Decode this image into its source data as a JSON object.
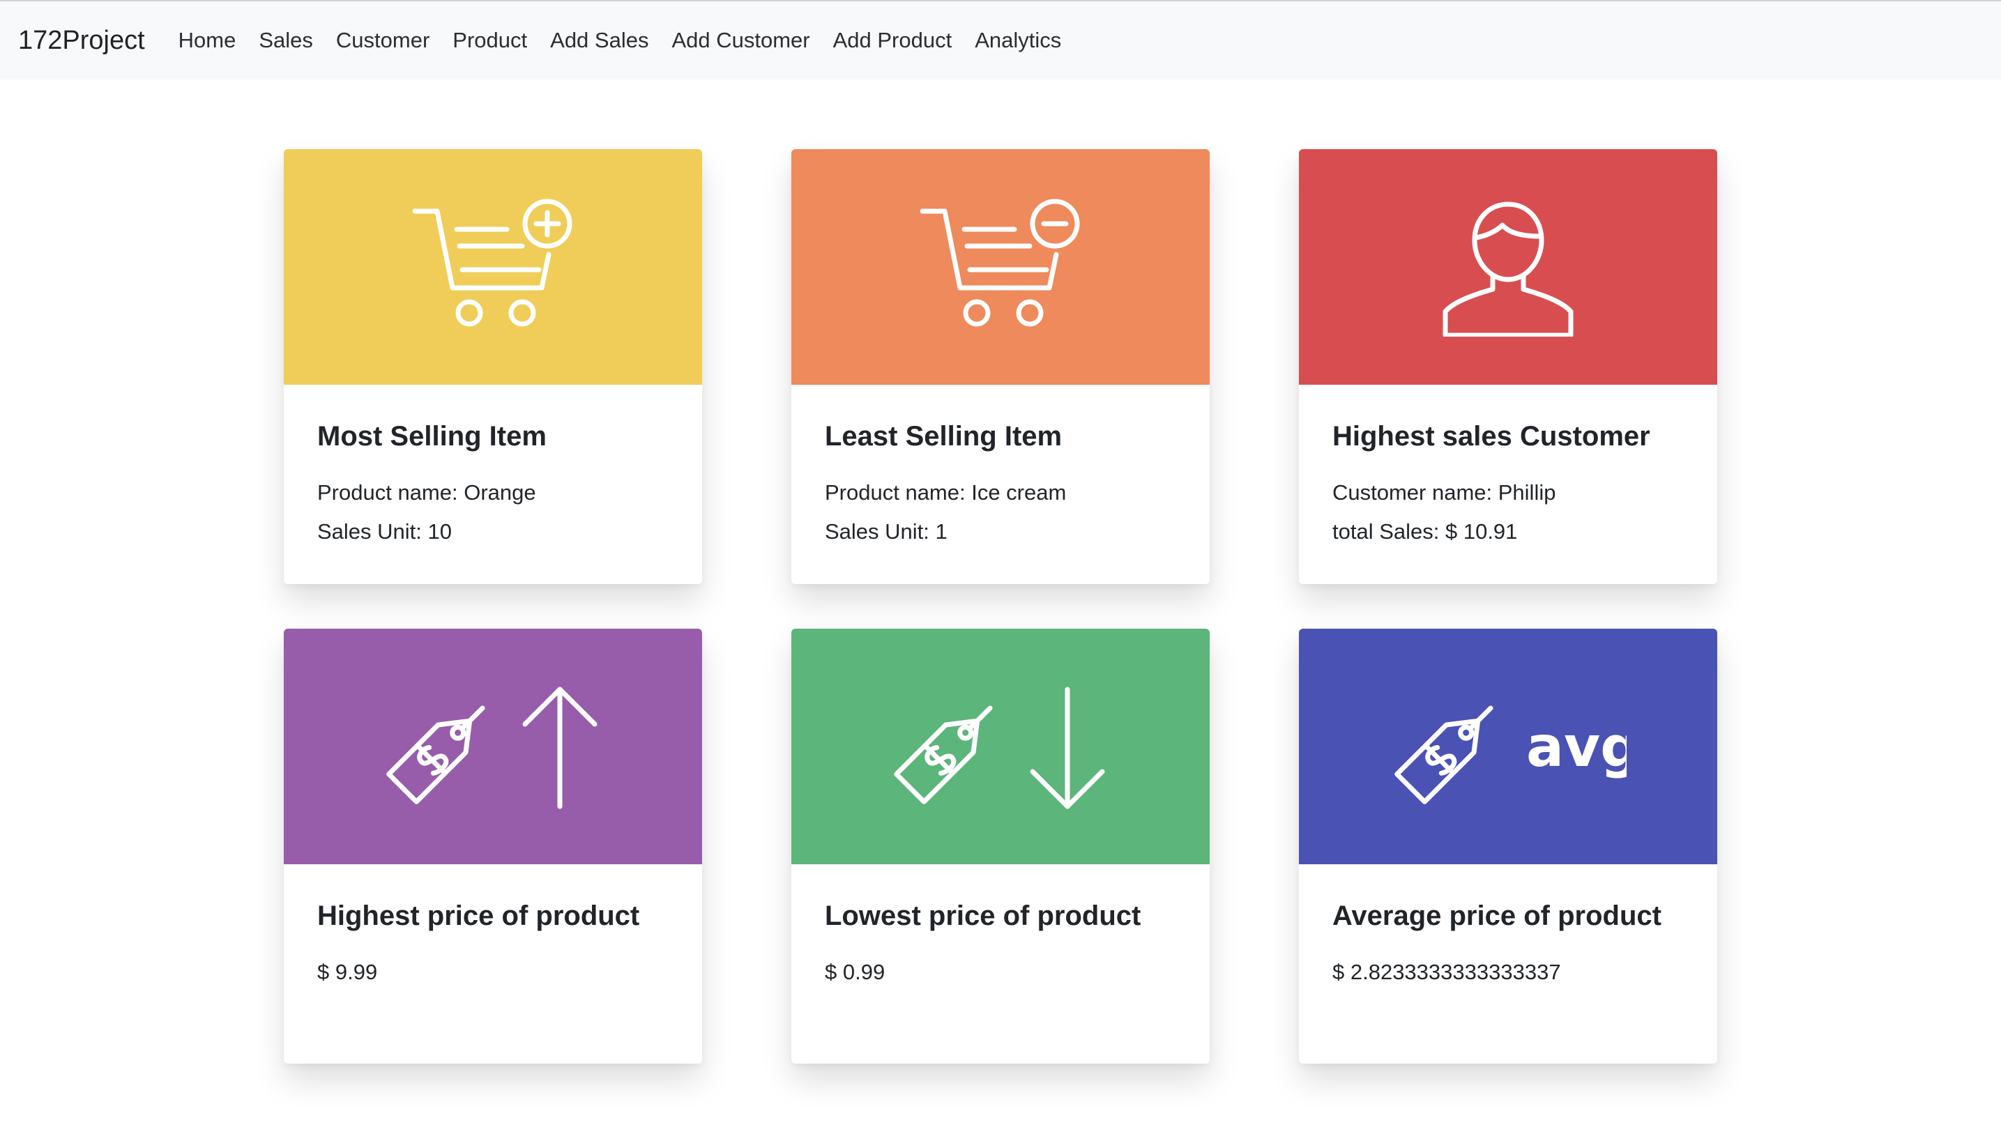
{
  "navbar": {
    "brand": "172Project",
    "links": [
      "Home",
      "Sales",
      "Customer",
      "Product",
      "Add Sales",
      "Add Customer",
      "Add Product",
      "Analytics"
    ]
  },
  "colors": {
    "yellow": "#efcd58",
    "orange": "#ee8a5b",
    "red": "#d84e50",
    "purple": "#975dab",
    "green": "#5cb57a",
    "indigo": "#4a52b4"
  },
  "cards": [
    {
      "icon": "cart-add-icon",
      "title": "Most Selling Item",
      "line1": "Product name: Orange",
      "line2": "Sales Unit: 10"
    },
    {
      "icon": "cart-remove-icon",
      "title": "Least Selling Item",
      "line1": "Product name: Ice cream",
      "line2": "Sales Unit: 1"
    },
    {
      "icon": "user-icon",
      "title": "Highest sales Customer",
      "line1": "Customer name: Phillip",
      "line2": "total Sales: $ 10.91"
    },
    {
      "icon": "price-tag-up-arrow-icon",
      "title": "Highest price of product",
      "line1": "$ 9.99"
    },
    {
      "icon": "price-tag-down-arrow-icon",
      "title": "Lowest price of product",
      "line1": "$ 0.99"
    },
    {
      "icon": "price-tag-avg-icon",
      "title": "Average price of product",
      "line1": "$ 2.8233333333333337",
      "icon_text": "avg"
    }
  ]
}
